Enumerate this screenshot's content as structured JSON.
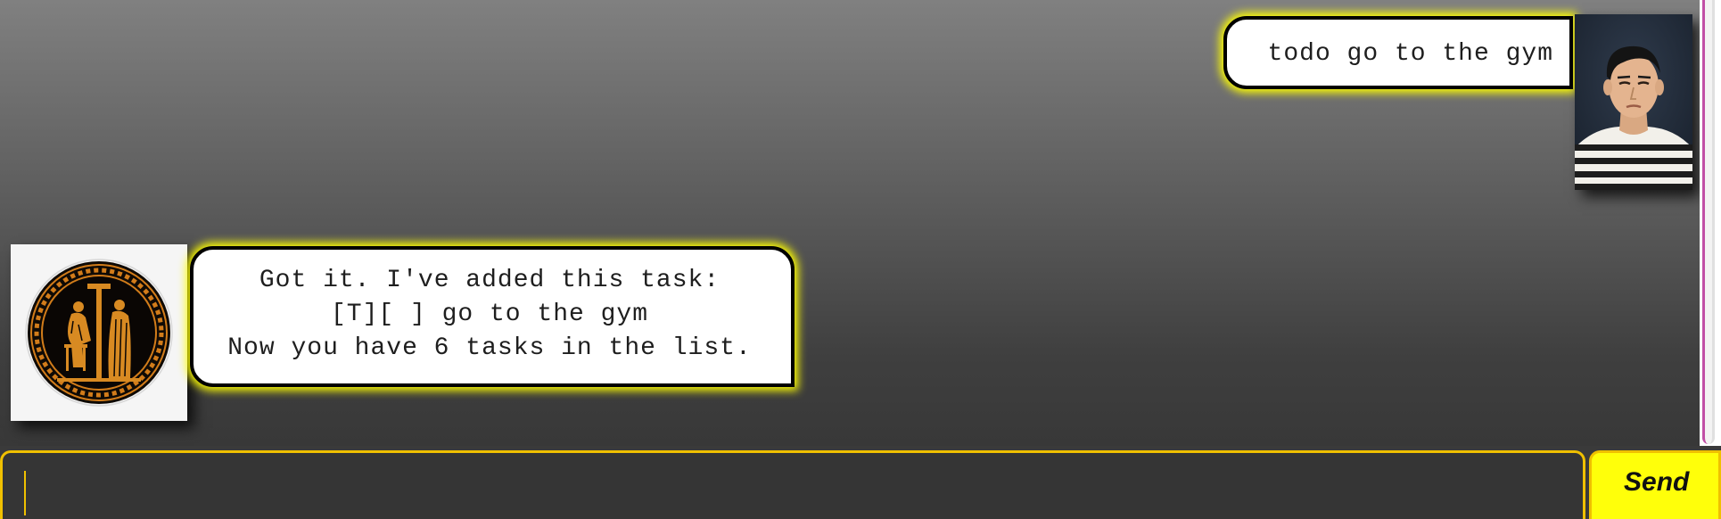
{
  "conversation": {
    "user_message": "todo go to the gym",
    "bot_message_lines": [
      "Got it. I've added this task:",
      "[T][ ] go to the gym",
      "Now you have 6 tasks in the list."
    ]
  },
  "input": {
    "value": "",
    "placeholder": ""
  },
  "send_button": {
    "label": "Send"
  },
  "avatars": {
    "user": "user-portrait",
    "bot": "greek-vase-medallion"
  },
  "colors": {
    "bubble_glow": "#ffff00",
    "input_border": "#f0c000",
    "send_button_bg": "#ffff0a",
    "scrollbar_accent": "#c14fa6"
  }
}
